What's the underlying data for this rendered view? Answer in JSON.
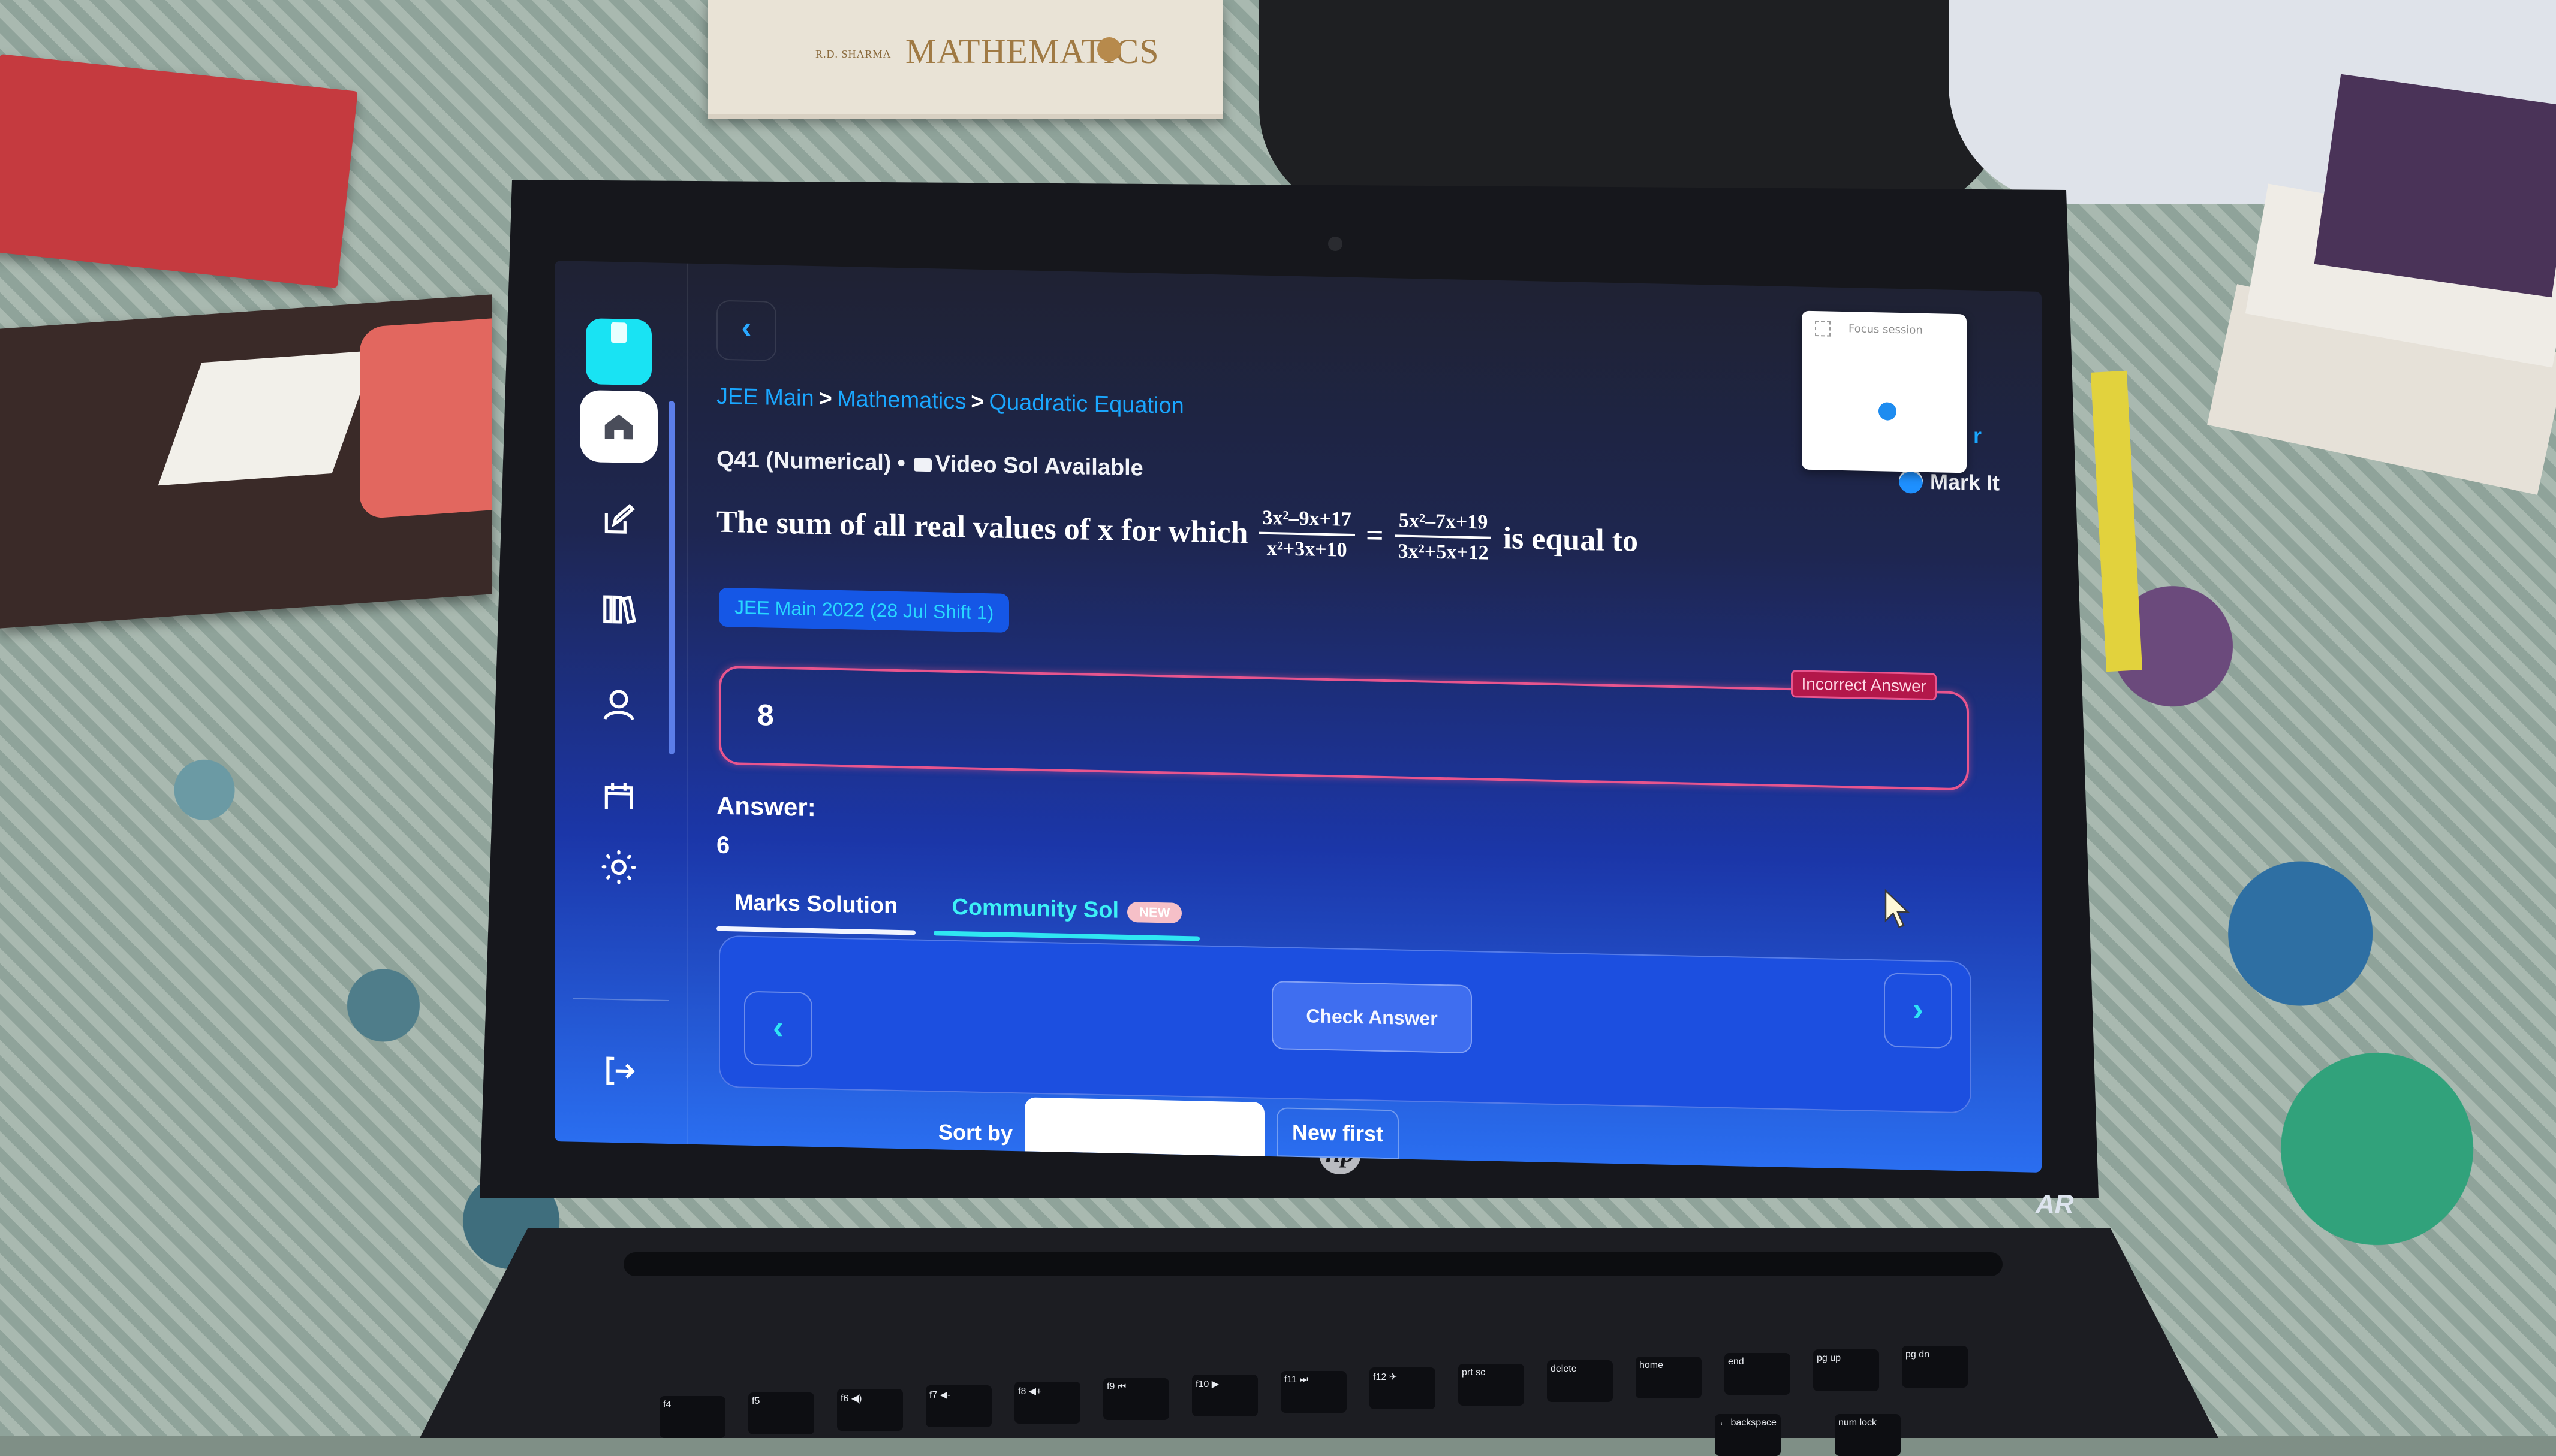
{
  "scene": {
    "book_spine": {
      "author": "R.D. SHARMA",
      "title": "MATHEMATICS"
    },
    "laptop_brand": "hp",
    "laptop_sticker": "AR",
    "keyboard_keys": [
      "f4",
      "f5",
      "f6 ◀)",
      "f7 ◀-",
      "f8 ◀+",
      "f9 ⏮",
      "f10 ▶",
      "f11 ⏭",
      "f12 ✈",
      "prt sc",
      "delete",
      "home",
      "end",
      "pg up",
      "pg dn",
      "← backspace",
      "num lock"
    ]
  },
  "app": {
    "sidebar": {
      "items": [
        {
          "name": "home",
          "icon": "home-icon",
          "active": true
        },
        {
          "name": "practice",
          "icon": "edit-icon",
          "active": false
        },
        {
          "name": "library",
          "icon": "library-icon",
          "active": false
        },
        {
          "name": "profile",
          "icon": "user-icon",
          "active": false
        },
        {
          "name": "calendar",
          "icon": "calendar-icon",
          "active": false
        },
        {
          "name": "theme",
          "icon": "sun-icon",
          "active": false
        },
        {
          "name": "logout",
          "icon": "logout-icon",
          "active": false
        }
      ]
    },
    "header": {
      "back_icon": "‹",
      "breadcrumb": [
        "JEE Main",
        "Mathematics",
        "Quadratic Equation"
      ],
      "breadcrumb_separator": ">"
    },
    "question": {
      "meta_id": "Q41 (Numerical)",
      "meta_separator": "•",
      "meta_video": "Video Sol Available",
      "text_before": "The sum of all real values of x for which",
      "lhs": {
        "numerator": "3x²–9x+17",
        "denominator": "x²+3x+10"
      },
      "equals": "=",
      "rhs": {
        "numerator": "5x²–7x+19",
        "denominator": "3x²+5x+12"
      },
      "text_after": "is equal to",
      "exam_tag": "JEE Main 2022 (28 Jul Shift 1)"
    },
    "mark_it_label": "Mark It",
    "peek_text": "r",
    "focus_widget": {
      "title": "Focus session"
    },
    "response": {
      "user_answer": "8",
      "status_badge": "Incorrect Answer",
      "status_color": "#e8558e",
      "answer_label": "Answer:",
      "correct_answer": "6"
    },
    "tabs": [
      {
        "label": "Marks Solution",
        "active": false
      },
      {
        "label": "Community Sol",
        "active": true,
        "badge": "NEW"
      }
    ],
    "solution_panel": {
      "prev_icon": "‹",
      "next_icon": "›",
      "check_answer_label": "Check Answer"
    },
    "sort": {
      "label": "Sort by",
      "selected": "",
      "option": "New first"
    },
    "colors": {
      "accent_cyan": "#2fe6f2",
      "breadcrumb_blue": "#1aa7ff",
      "logo_cyan": "#19e3f3"
    }
  }
}
